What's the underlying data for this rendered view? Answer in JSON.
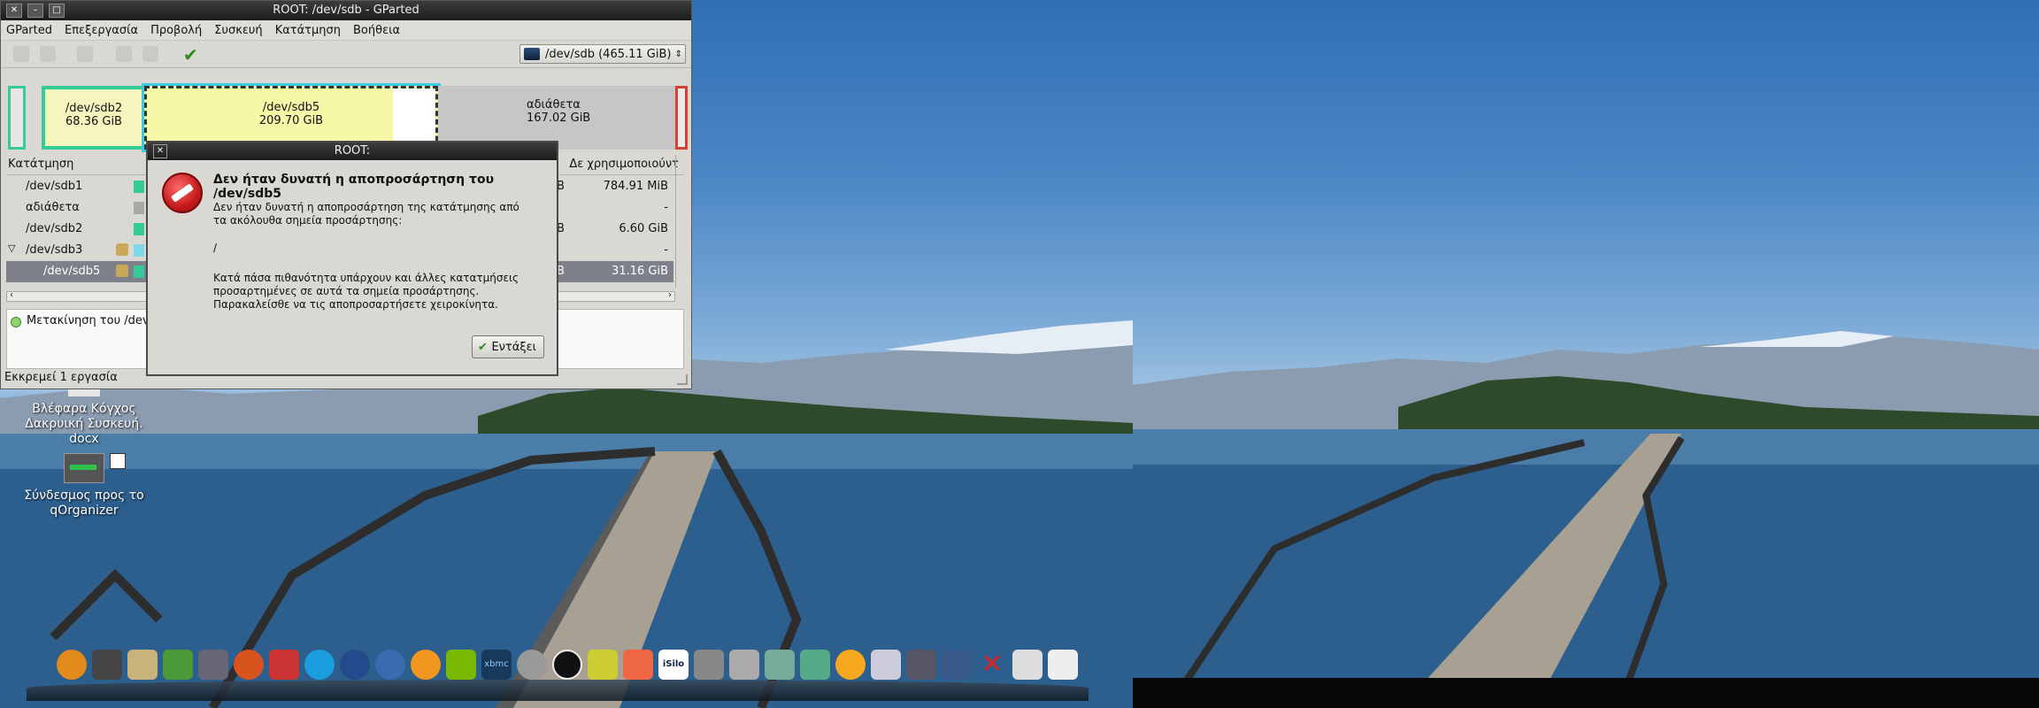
{
  "gparted": {
    "window_title": "ROOT: /dev/sdb - GParted",
    "menu": [
      "GParted",
      "Επεξεργασία",
      "Προβολή",
      "Συσκευή",
      "Κατάτμηση",
      "Βοήθεια"
    ],
    "device": "/dev/sdb  (465.11 GiB)",
    "partition_map": {
      "sdb2": {
        "name": "/dev/sdb2",
        "size": "68.36 GiB"
      },
      "sdb5": {
        "name": "/dev/sdb5",
        "size": "209.70 GiB"
      },
      "unallocated": {
        "name": "αδιάθετα",
        "size": "167.02 GiB"
      }
    },
    "columns": {
      "partition": "Κατάτμηση",
      "unused": "Δε χρησιμοποιούντ"
    },
    "rows": [
      {
        "name": "/dev/sdb1",
        "color": "#33cc99",
        "mid": "B",
        "unused": "784.91 MiB"
      },
      {
        "name": "αδιάθετα",
        "color": "#a8a8a8",
        "mid": "",
        "unused": "-"
      },
      {
        "name": "/dev/sdb2",
        "color": "#33cc99",
        "mid": "B",
        "unused": "6.60 GiB"
      },
      {
        "name": "/dev/sdb3",
        "color": "#7ed9e8",
        "mid": "",
        "unused": "-"
      },
      {
        "name": "/dev/sdb5",
        "color": "#33cc99",
        "mid": "B",
        "unused": "31.16 GiB"
      }
    ],
    "pending_operation": "Μετακίνηση του /dev/",
    "status": "Εκκρεμεί 1 εργασία"
  },
  "dialog": {
    "title": "ROOT:",
    "heading": "Δεν ήταν δυνατή η αποπροσάρτηση του /dev/sdb5",
    "line1": "Δεν ήταν δυνατή η αποπροσάρτηση της κατάτμησης από",
    "line2": "τα ακόλουθα σημεία προσάρτησης:",
    "mountpoint": "/",
    "line3": "Κατά πάσα πιθανότητα υπάρχουν και άλλες κατατμήσεις",
    "line4": "προσαρτημένες σε αυτά τα σημεία προσάρτησης.",
    "line5": "Παρακαλείσθε να τις αποπροσαρτήσετε χειροκίνητα.",
    "ok_label": "Εντάξει"
  },
  "desktop": {
    "icon_docx": "Βλέφαρα Κόγχος Δακρυική Συσκευή. docx",
    "icon_link": "Σύνδεσμος προς το qOrganizer"
  },
  "dock": {
    "items": [
      "fire-icon",
      "film-icon",
      "folder-icon",
      "terminal-icon",
      "monitor-icon",
      "firefox-icon",
      "synaptic-icon",
      "skype-icon",
      "earth-icon",
      "globe-icon",
      "swirl-icon",
      "nvidia-icon",
      "xbmc-icon",
      "aqua-icon",
      "a-icon",
      "jar-icon",
      "box-icon",
      "isilo-icon",
      "camera-icon",
      "camera2-icon",
      "chart-icon",
      "board-icon",
      "clock-icon",
      "printer-icon",
      "screen-icon",
      "window-icon",
      "x-icon",
      "mail-icon",
      "file-icon"
    ],
    "isilo_label": "iSilo",
    "xbmc_label": "xbmc"
  }
}
